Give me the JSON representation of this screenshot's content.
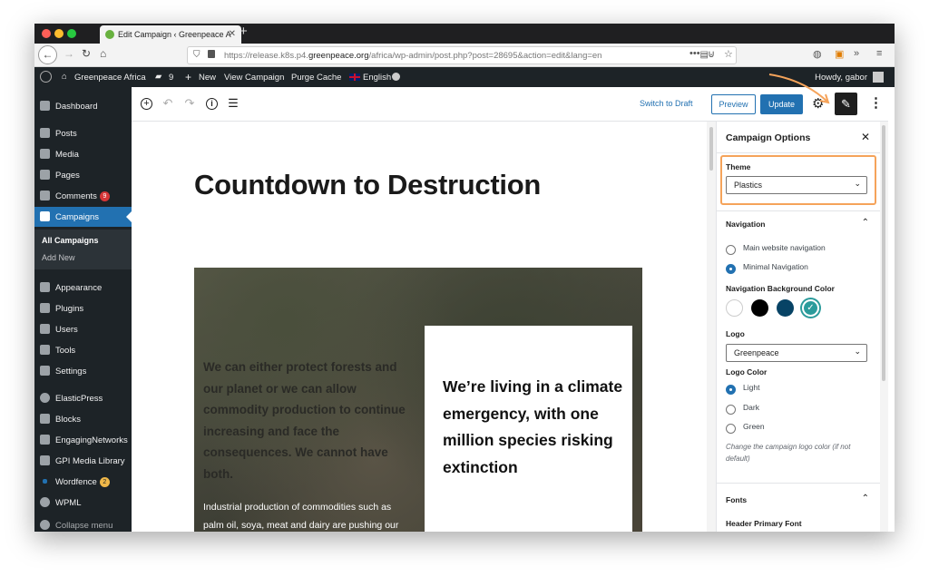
{
  "browser": {
    "tab_title": "Edit Campaign ‹ Greenpeace A",
    "url_prefix": "https://release.k8s.p4.",
    "url_domain": "greenpeace.org",
    "url_rest": "/africa/wp-admin/post.php?post=28695&action=edit&lang=en"
  },
  "adminbar": {
    "site_name": "Greenpeace Africa",
    "comments_count": "9",
    "new_label": "New",
    "view_campaign": "View Campaign",
    "purge_cache": "Purge Cache",
    "language": "English",
    "howdy": "Howdy, gabor"
  },
  "sidebar": {
    "items": [
      {
        "label": "Dashboard",
        "icon": "dashboard-icon"
      },
      {
        "label": "Posts",
        "icon": "pin-icon"
      },
      {
        "label": "Media",
        "icon": "media-icon"
      },
      {
        "label": "Pages",
        "icon": "pages-icon"
      },
      {
        "label": "Comments",
        "icon": "comment-icon",
        "badge": "9"
      },
      {
        "label": "Campaigns",
        "icon": "megaphone-icon"
      },
      {
        "label": "Appearance",
        "icon": "brush-icon"
      },
      {
        "label": "Plugins",
        "icon": "plugin-icon"
      },
      {
        "label": "Users",
        "icon": "users-icon"
      },
      {
        "label": "Tools",
        "icon": "wrench-icon"
      },
      {
        "label": "Settings",
        "icon": "settings-icon"
      },
      {
        "label": "ElasticPress",
        "icon": "elasticpress-icon"
      },
      {
        "label": "Blocks",
        "icon": "blocks-icon"
      },
      {
        "label": "EngagingNetworks",
        "icon": "grid-icon"
      },
      {
        "label": "GPI Media Library",
        "icon": "media-library-icon"
      },
      {
        "label": "Wordfence",
        "icon": "wordfence-icon",
        "badge": "2"
      },
      {
        "label": "WPML",
        "icon": "wpml-icon"
      },
      {
        "label": "Collapse menu",
        "icon": "collapse-icon"
      }
    ],
    "sub_all": "All Campaigns",
    "sub_add": "Add New"
  },
  "toolbar": {
    "switch_draft": "Switch to Draft",
    "preview": "Preview",
    "update": "Update"
  },
  "content": {
    "title": "Countdown to Destruction",
    "hero_text": "We can either protect forests and our planet or we can allow commodity production to continue increasing and face the consequences. We cannot have both.",
    "hero_small": "Industrial production of commodities such as palm oil, soya, meat and dairy are pushing our",
    "card_text": "We’re living in a climate emergency, with one million species risking extinction"
  },
  "panel": {
    "title": "Campaign Options",
    "theme_label": "Theme",
    "theme_value": "Plastics",
    "navigation_heading": "Navigation",
    "nav_option_main": "Main website navigation",
    "nav_option_minimal": "Minimal Navigation",
    "nav_bg_label": "Navigation Background Color",
    "swatches": [
      "#ffffff",
      "#000000",
      "#074365",
      "#2b9b9b"
    ],
    "logo_label": "Logo",
    "logo_value": "Greenpeace",
    "logo_color_label": "Logo Color",
    "logo_light": "Light",
    "logo_dark": "Dark",
    "logo_green": "Green",
    "logo_help": "Change the campaign logo color (if not default)",
    "fonts_heading": "Fonts",
    "header_font_label": "Header Primary Font"
  },
  "colors": {
    "accent": "#2271b1",
    "highlight": "#f5a35a",
    "admin_dark": "#1d2327"
  }
}
